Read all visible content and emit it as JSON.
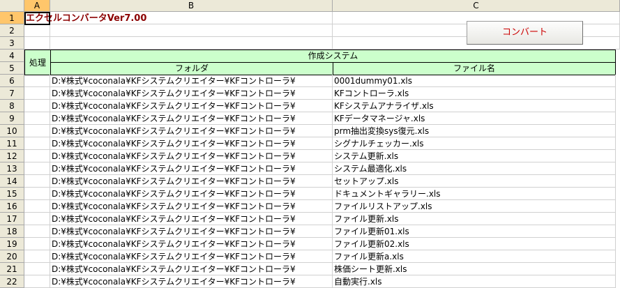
{
  "columns": [
    "A",
    "B",
    "C"
  ],
  "rows": [
    "1",
    "2",
    "3",
    "4",
    "5",
    "6",
    "7",
    "8",
    "9",
    "10",
    "11",
    "12",
    "13",
    "14",
    "15",
    "16",
    "17",
    "18",
    "19",
    "20",
    "21",
    "22"
  ],
  "title": "エクセルコンバータVer7.00",
  "convert_button": "コンバート",
  "header": {
    "process": "処理",
    "system": "作成システム",
    "folder": "フォルダ",
    "filename": "ファイル名"
  },
  "data_rows": [
    {
      "folder": "D:¥株式¥coconala¥KFシステムクリエイター¥KFコントローラ¥",
      "file": "0001dummy01.xls"
    },
    {
      "folder": "D:¥株式¥coconala¥KFシステムクリエイター¥KFコントローラ¥",
      "file": "KFコントローラ.xls"
    },
    {
      "folder": "D:¥株式¥coconala¥KFシステムクリエイター¥KFコントローラ¥",
      "file": "KFシステムアナライザ.xls"
    },
    {
      "folder": "D:¥株式¥coconala¥KFシステムクリエイター¥KFコントローラ¥",
      "file": "KFデータマネージャ.xls"
    },
    {
      "folder": "D:¥株式¥coconala¥KFシステムクリエイター¥KFコントローラ¥",
      "file": "prm抽出変換sys復元.xls"
    },
    {
      "folder": "D:¥株式¥coconala¥KFシステムクリエイター¥KFコントローラ¥",
      "file": "シグナルチェッカー.xls"
    },
    {
      "folder": "D:¥株式¥coconala¥KFシステムクリエイター¥KFコントローラ¥",
      "file": "システム更新.xls"
    },
    {
      "folder": "D:¥株式¥coconala¥KFシステムクリエイター¥KFコントローラ¥",
      "file": "システム最適化.xls"
    },
    {
      "folder": "D:¥株式¥coconala¥KFシステムクリエイター¥KFコントローラ¥",
      "file": "セットアップ.xls"
    },
    {
      "folder": "D:¥株式¥coconala¥KFシステムクリエイター¥KFコントローラ¥",
      "file": "ドキュメントギャラリー.xls"
    },
    {
      "folder": "D:¥株式¥coconala¥KFシステムクリエイター¥KFコントローラ¥",
      "file": "ファイルリストアップ.xls"
    },
    {
      "folder": "D:¥株式¥coconala¥KFシステムクリエイター¥KFコントローラ¥",
      "file": "ファイル更新.xls"
    },
    {
      "folder": "D:¥株式¥coconala¥KFシステムクリエイター¥KFコントローラ¥",
      "file": "ファイル更新01.xls"
    },
    {
      "folder": "D:¥株式¥coconala¥KFシステムクリエイター¥KFコントローラ¥",
      "file": "ファイル更新02.xls"
    },
    {
      "folder": "D:¥株式¥coconala¥KFシステムクリエイター¥KFコントローラ¥",
      "file": "ファイル更新a.xls"
    },
    {
      "folder": "D:¥株式¥coconala¥KFシステムクリエイター¥KFコントローラ¥",
      "file": "株価シート更新.xls"
    },
    {
      "folder": "D:¥株式¥coconala¥KFシステムクリエイター¥KFコントローラ¥",
      "file": "自動実行.xls"
    }
  ]
}
